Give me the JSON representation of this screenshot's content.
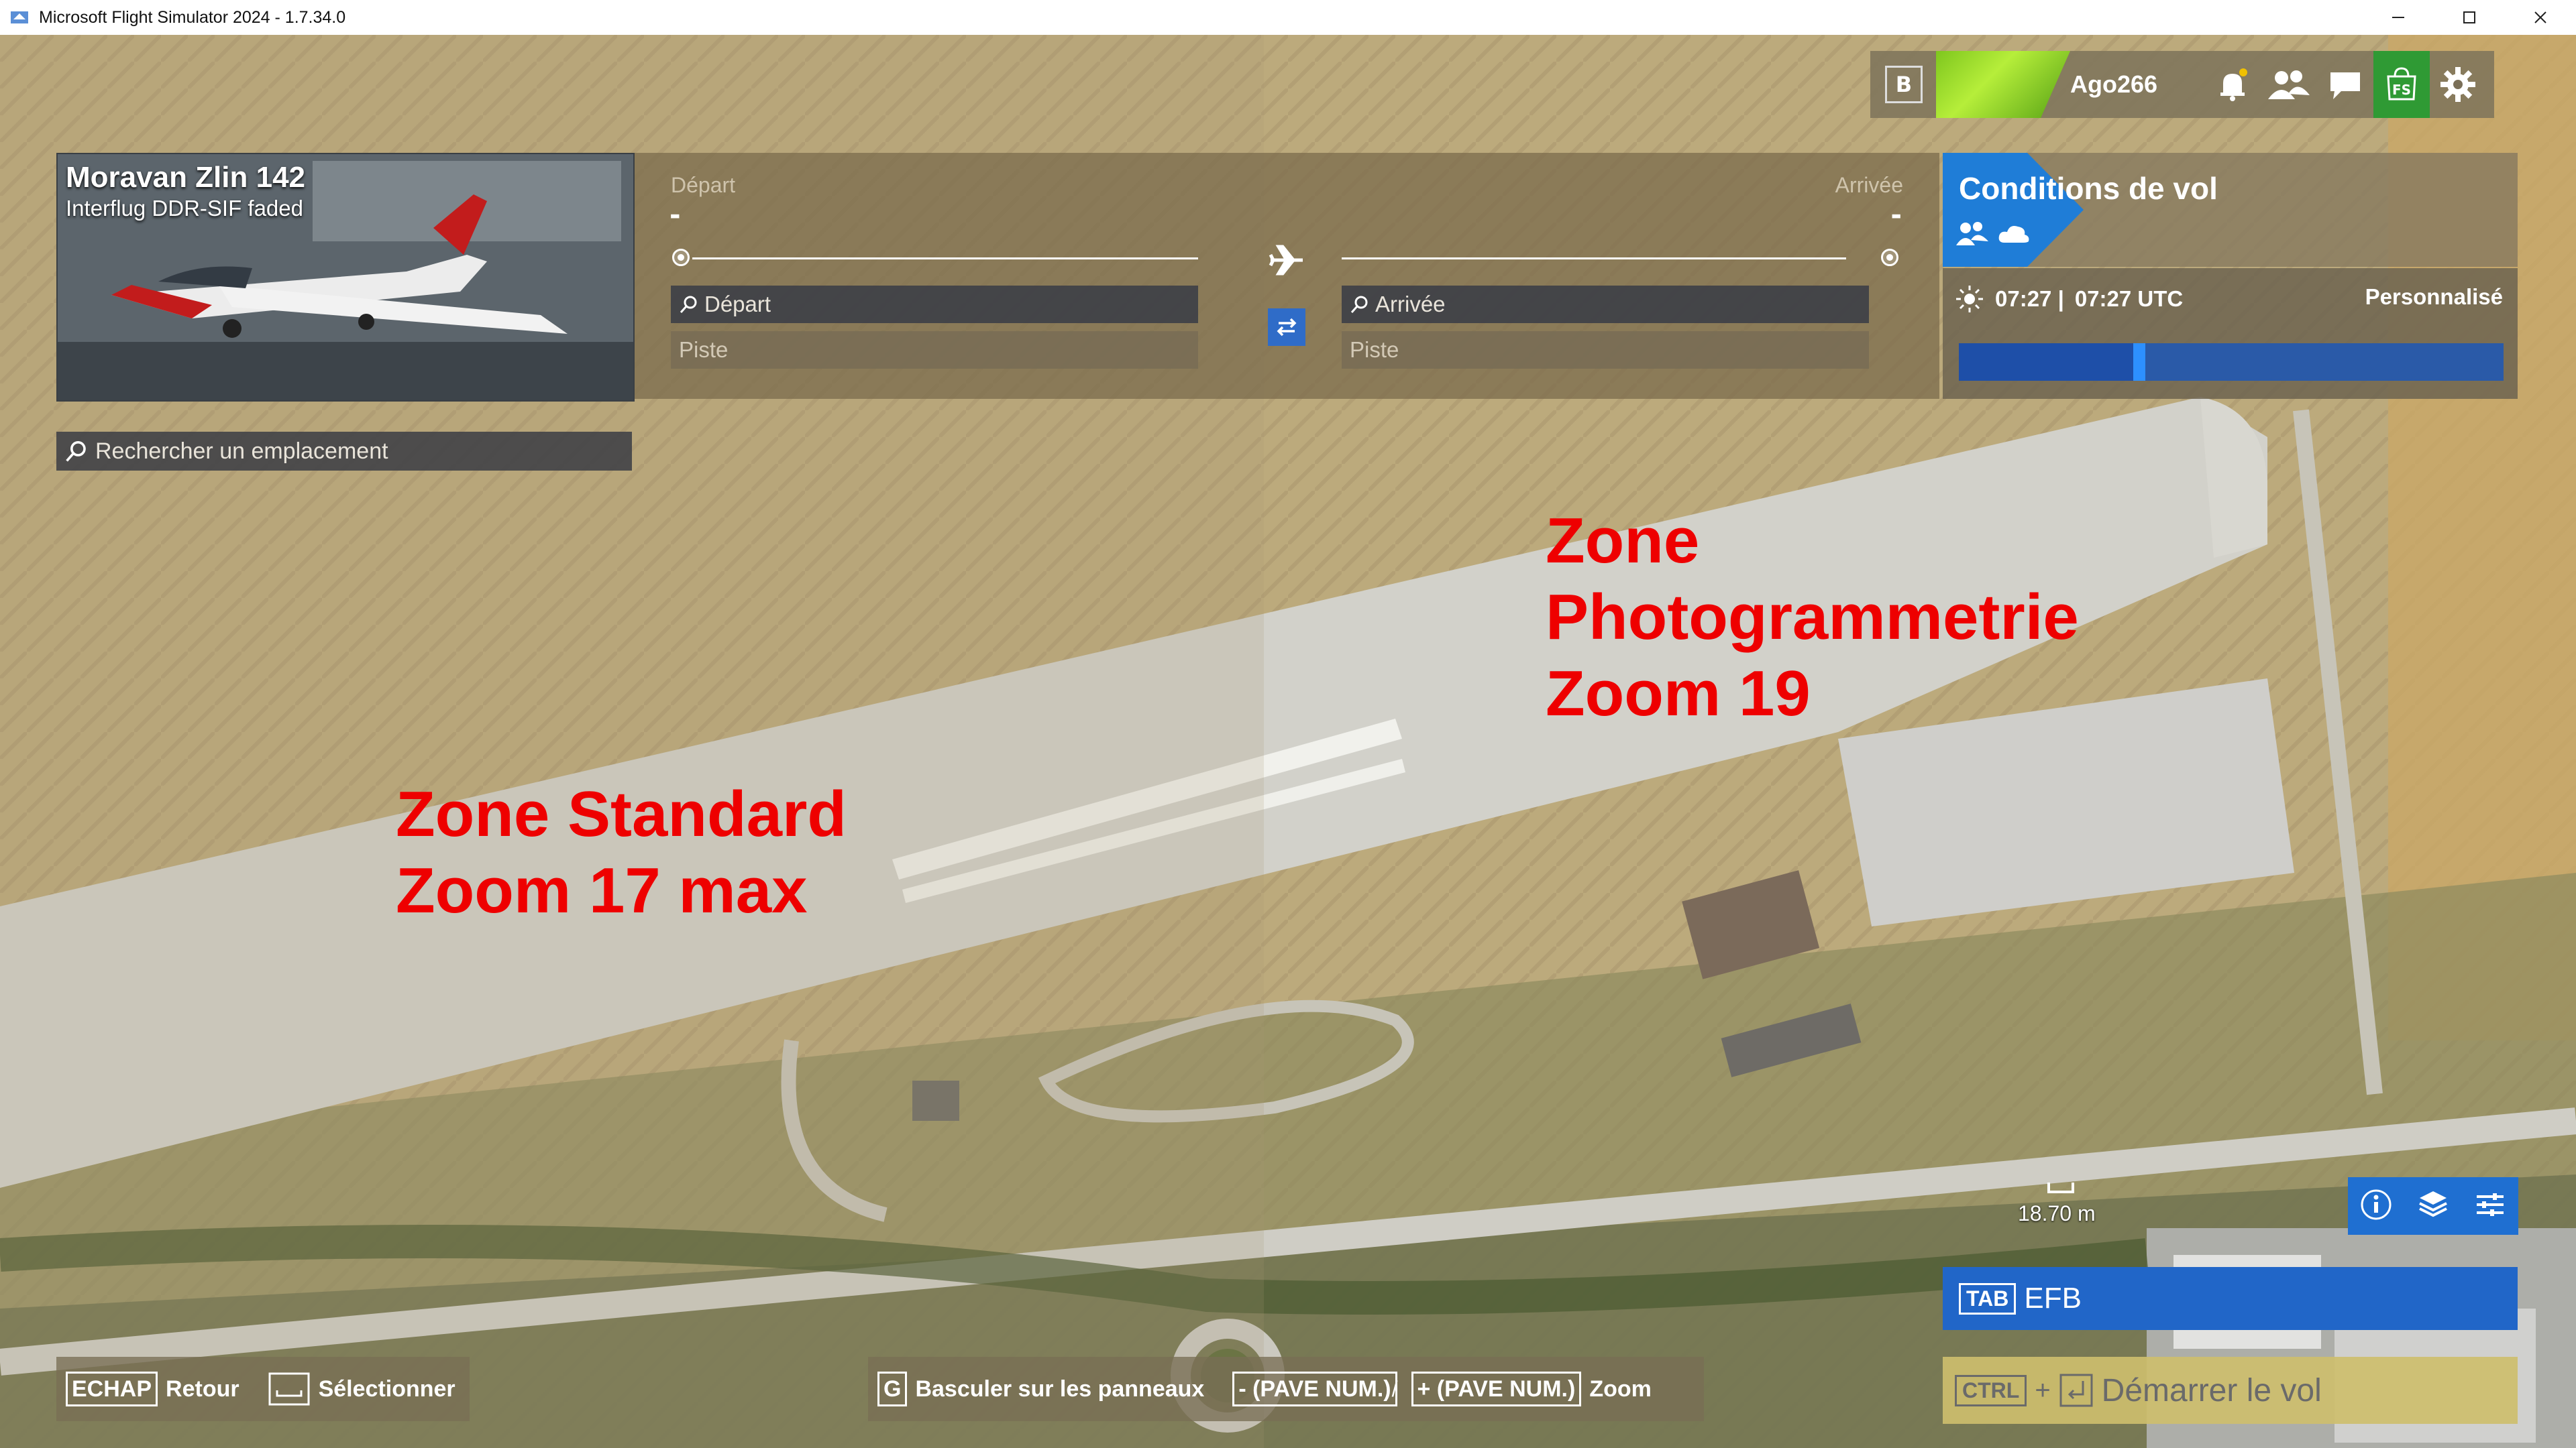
{
  "window": {
    "title": "Microsoft Flight Simulator 2024 - 1.7.34.0",
    "controls": [
      "minimize-icon",
      "maximize-icon",
      "close-icon"
    ]
  },
  "aircraft": {
    "name": "Moravan Zlin 142",
    "livery": "Interflug DDR-SIF faded"
  },
  "route": {
    "departure_label": "Départ",
    "arrival_label": "Arrivée",
    "departure_value": "-",
    "arrival_value": "-",
    "departure_search_placeholder": "Départ",
    "arrival_search_placeholder": "Arrivée",
    "departure_runway_placeholder": "Piste",
    "arrival_runway_placeholder": "Piste"
  },
  "conditions": {
    "title": "Conditions de vol",
    "local_time": "07:27 |",
    "utc_time": "07:27 UTC",
    "preset": "Personnalisé",
    "time_progress": 0.32
  },
  "userbar": {
    "key": "B",
    "username": "Ago266",
    "icons": [
      "bell-icon",
      "friends-icon",
      "chat-icon",
      "marketplace-icon",
      "gear-icon"
    ]
  },
  "search": {
    "placeholder": "Rechercher un emplacement"
  },
  "annotations": {
    "right_line1": "Zone",
    "right_line2": "Photogrammetrie",
    "right_line3": "Zoom 19",
    "left_line1": "Zone Standard",
    "left_line2": "Zoom 17 max"
  },
  "map": {
    "scale": "18.70  m",
    "tools": [
      "info-icon",
      "layers-icon",
      "filters-icon"
    ]
  },
  "actions": {
    "efb_key": "TAB",
    "efb_label": "EFB",
    "start_key": "CTRL",
    "start_plus": "+",
    "start_label": "Démarrer le vol"
  },
  "hints": {
    "back_key": "ECHAP",
    "back_label": "Retour",
    "select_label": "Sélectionner",
    "toggle_key": "G",
    "toggle_label": "Basculer sur les panneaux",
    "zoom_out_key": "- (PAVE NUM.)",
    "sep": "/",
    "zoom_in_key": "+ (PAVE NUM.)",
    "zoom_label": "Zoom"
  },
  "colors": {
    "accent_blue": "#1f6fd1",
    "annotation_red": "#ee0000",
    "shop_green": "#2f9a34"
  }
}
